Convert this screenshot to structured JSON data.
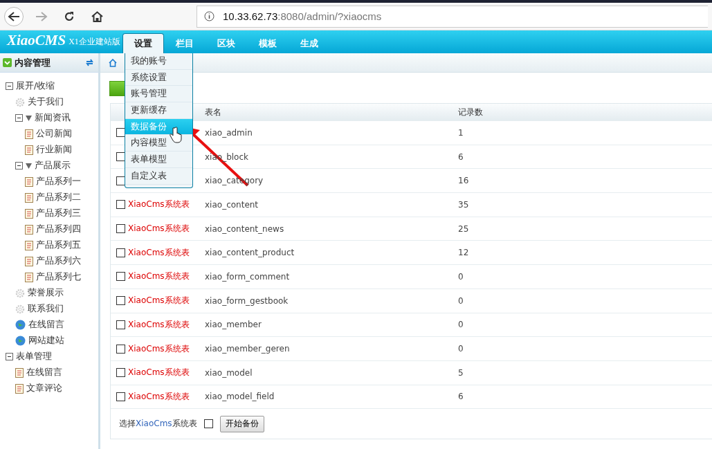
{
  "browser": {
    "url_host": "10.33.62.73",
    "url_rest": ":8080/admin/?xiaocms"
  },
  "header": {
    "logo": "XiaoCMS",
    "edition": "X1企业建站版",
    "nav": [
      {
        "label": "设置",
        "selected": true
      },
      {
        "label": "栏目",
        "selected": false
      },
      {
        "label": "区块",
        "selected": false
      },
      {
        "label": "模板",
        "selected": false
      },
      {
        "label": "生成",
        "selected": false
      }
    ]
  },
  "menu": {
    "items": [
      {
        "label": "我的账号",
        "selected": false
      },
      {
        "label": "系统设置",
        "selected": false
      },
      {
        "label": "账号管理",
        "selected": false
      },
      {
        "label": "更新缓存",
        "selected": false
      },
      {
        "label": "数据备份",
        "selected": true
      },
      {
        "label": "内容模型",
        "selected": false
      },
      {
        "label": "表单模型",
        "selected": false
      },
      {
        "label": "自定义表",
        "selected": false
      }
    ]
  },
  "sidebar": {
    "title": "内容管理",
    "tree": [
      {
        "label": "展开/收缩",
        "kind": "root",
        "expanded": true,
        "children": [
          {
            "label": "关于我们",
            "kind": "gear"
          },
          {
            "label": "新闻资讯",
            "kind": "folder",
            "expanded": true,
            "children": [
              {
                "label": "公司新闻",
                "kind": "doc"
              },
              {
                "label": "行业新闻",
                "kind": "doc"
              }
            ]
          },
          {
            "label": "产品展示",
            "kind": "folder",
            "expanded": true,
            "children": [
              {
                "label": "产品系列一",
                "kind": "doc"
              },
              {
                "label": "产品系列二",
                "kind": "doc"
              },
              {
                "label": "产品系列三",
                "kind": "doc"
              },
              {
                "label": "产品系列四",
                "kind": "doc"
              },
              {
                "label": "产品系列五",
                "kind": "doc"
              },
              {
                "label": "产品系列六",
                "kind": "doc"
              },
              {
                "label": "产品系列七",
                "kind": "doc"
              }
            ]
          },
          {
            "label": "荣誉展示",
            "kind": "gear"
          },
          {
            "label": "联系我们",
            "kind": "gear"
          },
          {
            "label": "在线留言",
            "kind": "globe"
          },
          {
            "label": "网站建站",
            "kind": "globe"
          }
        ]
      },
      {
        "label": "表单管理",
        "kind": "root",
        "expanded": true,
        "children": [
          {
            "label": "在线留言",
            "kind": "doc"
          },
          {
            "label": "文章评论",
            "kind": "doc"
          }
        ]
      }
    ]
  },
  "table": {
    "columns": [
      "表名",
      "记录数"
    ],
    "rows": [
      {
        "checked": false,
        "name": "xiao_admin",
        "count": "1"
      },
      {
        "checked": false,
        "name": "xiao_block",
        "count": "6"
      },
      {
        "checked": false,
        "name": "xiao_category",
        "count": "16"
      },
      {
        "checked": false,
        "type": "XiaoCms系统表",
        "name": "xiao_content",
        "count": "35"
      },
      {
        "checked": false,
        "type": "XiaoCms系统表",
        "name": "xiao_content_news",
        "count": "25"
      },
      {
        "checked": false,
        "type": "XiaoCms系统表",
        "name": "xiao_content_product",
        "count": "12"
      },
      {
        "checked": false,
        "type": "XiaoCms系统表",
        "name": "xiao_form_comment",
        "count": "0"
      },
      {
        "checked": false,
        "type": "XiaoCms系统表",
        "name": "xiao_form_gestbook",
        "count": "0"
      },
      {
        "checked": false,
        "type": "XiaoCms系统表",
        "name": "xiao_member",
        "count": "0"
      },
      {
        "checked": false,
        "type": "XiaoCms系统表",
        "name": "xiao_member_geren",
        "count": "0"
      },
      {
        "checked": false,
        "type": "XiaoCms系统表",
        "name": "xiao_model",
        "count": "5"
      },
      {
        "checked": false,
        "type": "XiaoCms系统表",
        "name": "xiao_model_field",
        "count": "6"
      }
    ]
  },
  "footer": {
    "label_parts": [
      "选择",
      "XiaoCms",
      "系统表"
    ],
    "checked": false,
    "button": "开始备份"
  }
}
